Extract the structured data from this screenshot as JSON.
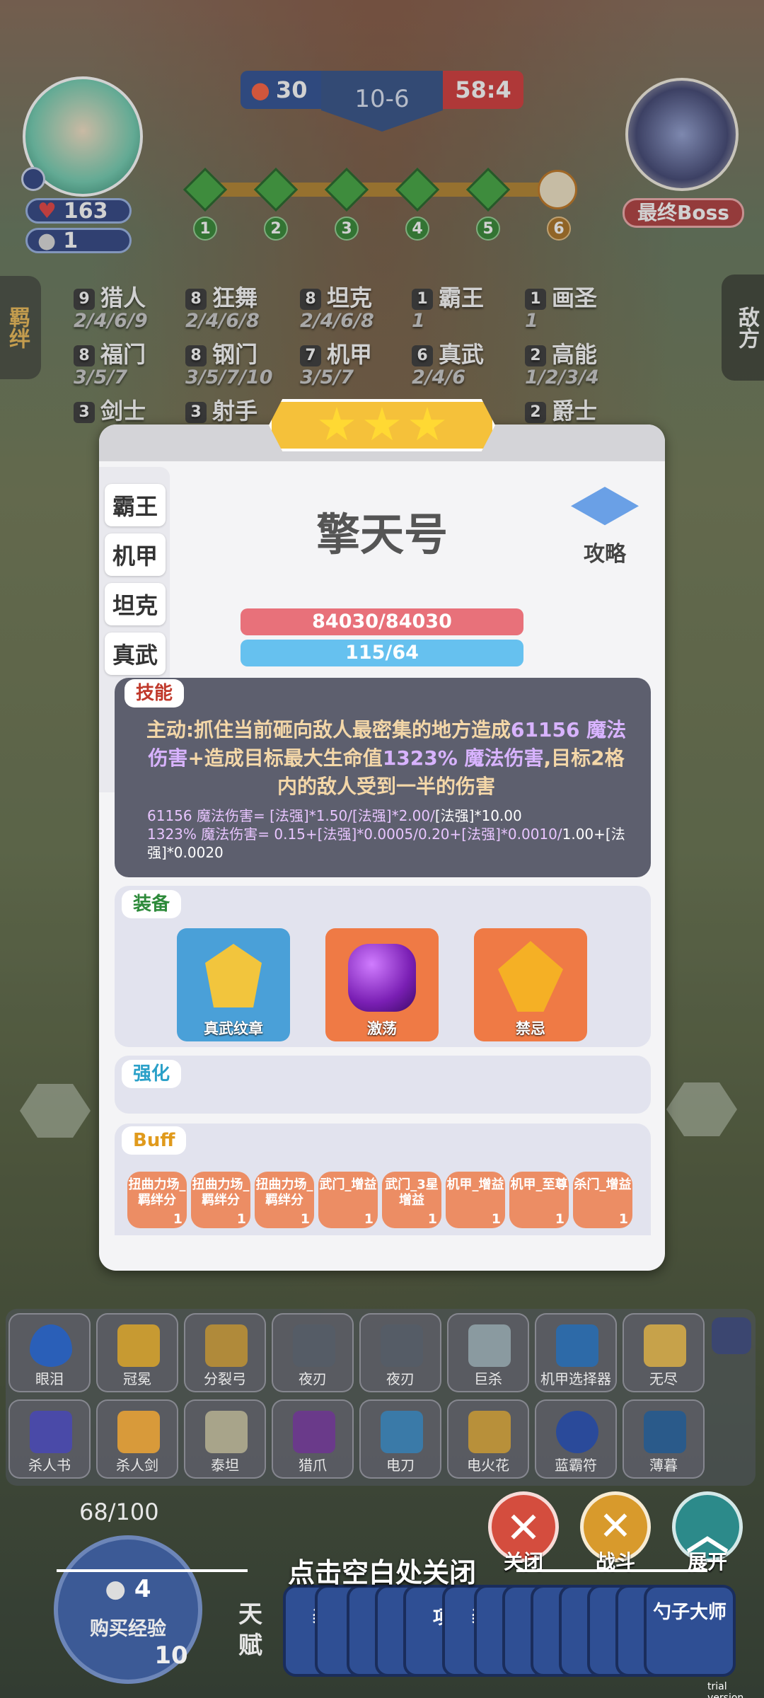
{
  "hud": {
    "hp": "163",
    "coins_small": "1",
    "round": "10-6",
    "streak": "30",
    "timer": "58:4",
    "boss_label": "最终Boss",
    "stages": [
      "1",
      "2",
      "3",
      "4",
      "5",
      "6"
    ]
  },
  "side_tabs": {
    "left": "羁绊",
    "right": "敌方"
  },
  "traits": [
    {
      "count": "9",
      "name": "猎人",
      "levels": "2/4/6/9"
    },
    {
      "count": "8",
      "name": "狂舞",
      "levels": "2/4/6/8"
    },
    {
      "count": "8",
      "name": "坦克",
      "levels": "2/4/6/8"
    },
    {
      "count": "1",
      "name": "霸王",
      "levels": "1"
    },
    {
      "count": "1",
      "name": "画圣",
      "levels": "1"
    },
    {
      "count": "8",
      "name": "福门",
      "levels": "3/5/7"
    },
    {
      "count": "8",
      "name": "钢门",
      "levels": "3/5/7/10"
    },
    {
      "count": "7",
      "name": "机甲",
      "levels": "3/5/7"
    },
    {
      "count": "6",
      "name": "真武",
      "levels": "2/4/6"
    },
    {
      "count": "2",
      "name": "高能",
      "levels": "1/2/3/4"
    },
    {
      "count": "3",
      "name": "剑士",
      "levels": ""
    },
    {
      "count": "3",
      "name": "射手",
      "levels": ""
    },
    {
      "count": "2",
      "name": "爵士",
      "levels": ""
    }
  ],
  "unit": {
    "stars": 3,
    "name": "擎天号",
    "guide": "攻略",
    "tags": [
      "霸王",
      "机甲",
      "坦克",
      "真武"
    ],
    "hp": "84030/84030",
    "mana": "115/64"
  },
  "skill": {
    "label": "技能",
    "part1": "主动:抓住当前砸向敌人最密集的地方造成",
    "num1": "61156 魔法伤害",
    "part2": "+造成目标最大生命值",
    "num2": "1323% 魔法伤害",
    "part3": ",目标2格内的敌人受到一半的伤害",
    "formula1a": "61156 魔法伤害= [法强]*1.50/[法强]*2.00/",
    "formula1b": "[法强]*10.00",
    "formula2a": "1323% 魔法伤害= 0.15+[法强]*0.0005/0.20+[法强]*0.0010/",
    "formula2b": "1.00+[法强]*0.0020"
  },
  "equipment": {
    "label": "装备",
    "items": [
      "真武纹章",
      "激荡",
      "禁忌"
    ]
  },
  "enhance": {
    "label": "强化"
  },
  "buffs": {
    "label": "Buff",
    "items": [
      {
        "name": "扭曲力场_羁绊分",
        "count": "1"
      },
      {
        "name": "扭曲力场_羁绊分",
        "count": "1"
      },
      {
        "name": "扭曲力场_羁绊分",
        "count": "1"
      },
      {
        "name": "武门_增益",
        "count": "1"
      },
      {
        "name": "武门_3星增益",
        "count": "1"
      },
      {
        "name": "机甲_增益",
        "count": "1"
      },
      {
        "name": "机甲_至尊",
        "count": "1"
      },
      {
        "name": "杀门_增益",
        "count": "1"
      }
    ]
  },
  "inventory": [
    [
      "眼泪",
      "冠冕",
      "分裂弓",
      "夜刃",
      "夜刃",
      "巨杀",
      "机甲选择器",
      "无尽"
    ],
    [
      "杀人书",
      "杀人剑",
      "泰坦",
      "猎爪",
      "电刀",
      "电火花",
      "蓝霸符",
      "薄暮"
    ]
  ],
  "bottom": {
    "xp": "68/100",
    "buy_cost": "4",
    "buy_label": "购买经验",
    "level": "10",
    "close_hint": "点击空白处关闭",
    "btn_close": "关闭",
    "btn_fight": "战斗",
    "btn_expand": "展开",
    "talent_label": "天赋",
    "talent_cards": [
      "装",
      "",
      "",
      "",
      "项",
      "装",
      "金",
      "",
      "",
      "",
      "弹",
      "锻",
      "勺子大师"
    ]
  },
  "watermark": "trial version",
  "colors": {
    "hp_bar": "#e8717a",
    "mana_bar": "#66c1ef",
    "skill_bg": "#5d5f6e",
    "accent": "#f5c13a"
  }
}
